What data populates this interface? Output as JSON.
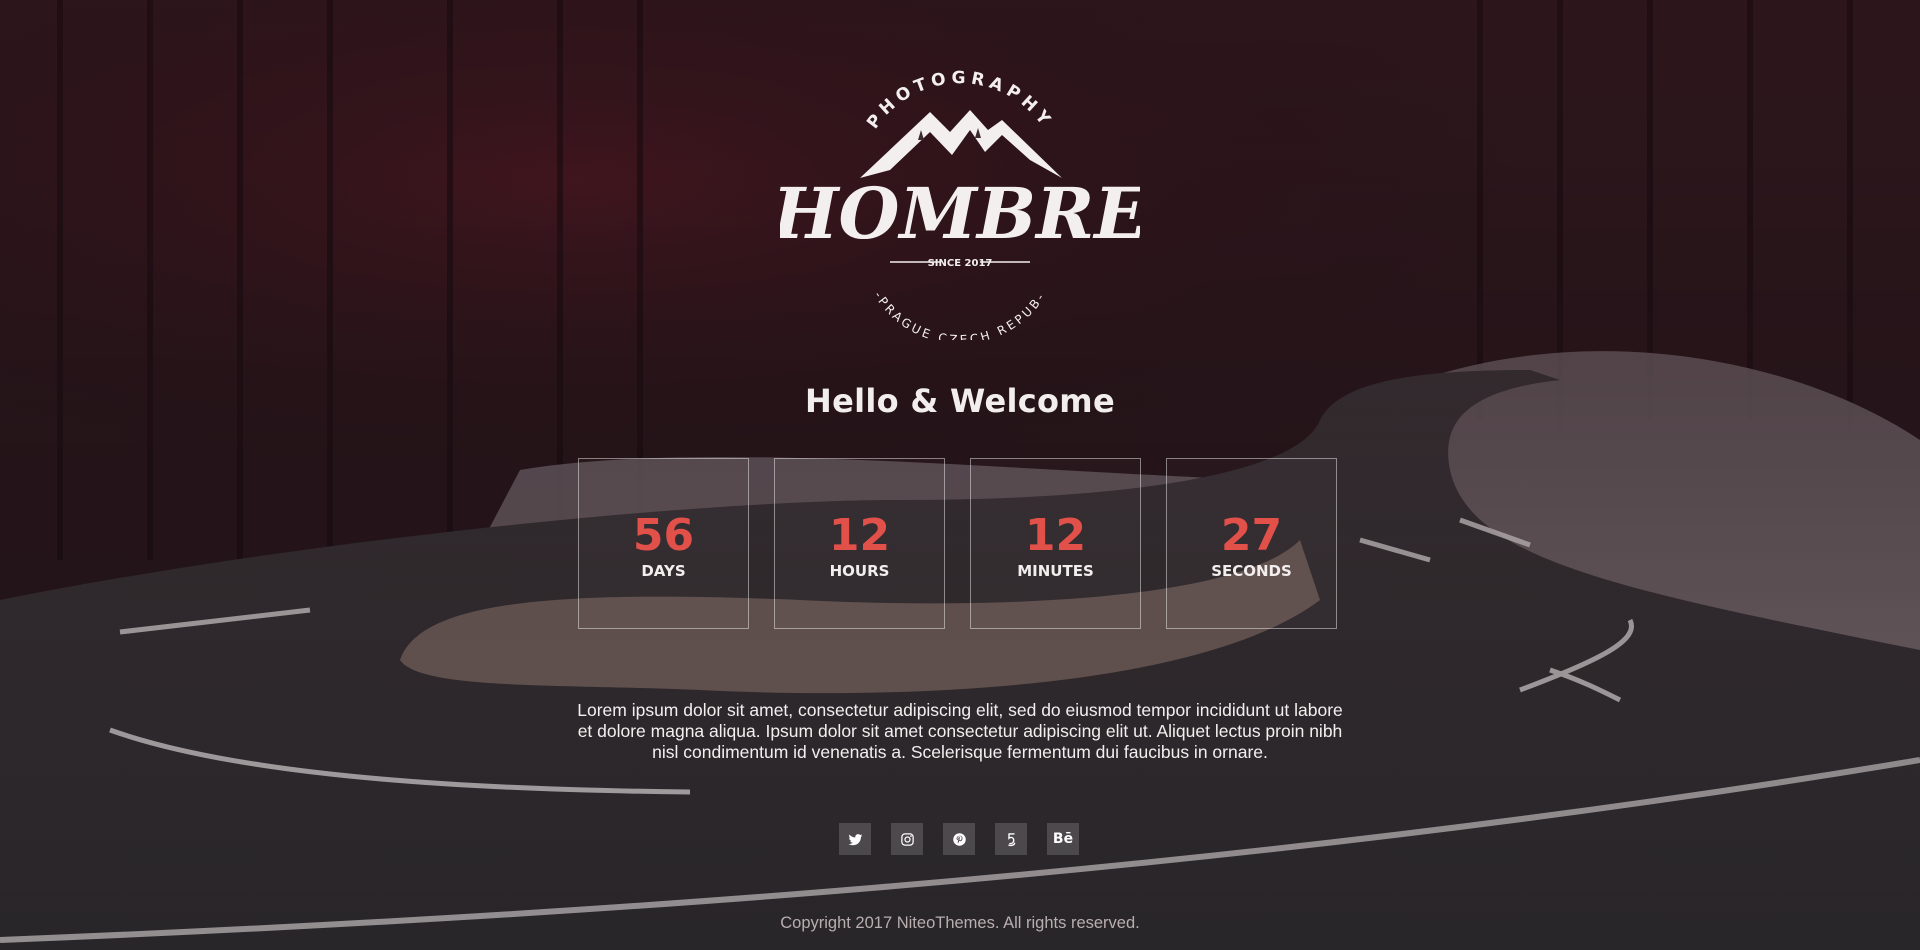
{
  "logo": {
    "arc_top": "PHOTOGRAPHY",
    "name": "HOMBRE",
    "since": "SINCE 2017",
    "arc_bottom": "-PRAGUE  CZECH REPUB-"
  },
  "welcome": "Hello & Welcome",
  "countdown": [
    {
      "value": "56",
      "label": "DAYS"
    },
    {
      "value": "12",
      "label": "HOURS"
    },
    {
      "value": "12",
      "label": "MINUTES"
    },
    {
      "value": "27",
      "label": "SECONDS"
    }
  ],
  "description": "Lorem ipsum dolor sit amet, consectetur adipiscing elit, sed do eiusmod tempor incididunt ut labore et dolore magna aliqua. Ipsum dolor sit amet consectetur adipiscing elit ut. Aliquet lectus proin nibh nisl condimentum id venenatis a. Scelerisque fermentum dui faucibus in ornare.",
  "social": [
    {
      "icon": "twitter-icon"
    },
    {
      "icon": "instagram-icon"
    },
    {
      "icon": "pinterest-icon"
    },
    {
      "icon": "500px-icon"
    },
    {
      "icon": "behance-icon",
      "text": "Bē"
    }
  ],
  "footer": "Copyright 2017 NiteoThemes. All rights reserved.",
  "colors": {
    "accent": "#e2504a",
    "text": "#f2eeee",
    "footer_text": "#b9aeb0",
    "box_border": "rgba(255,255,255,0.45)"
  }
}
